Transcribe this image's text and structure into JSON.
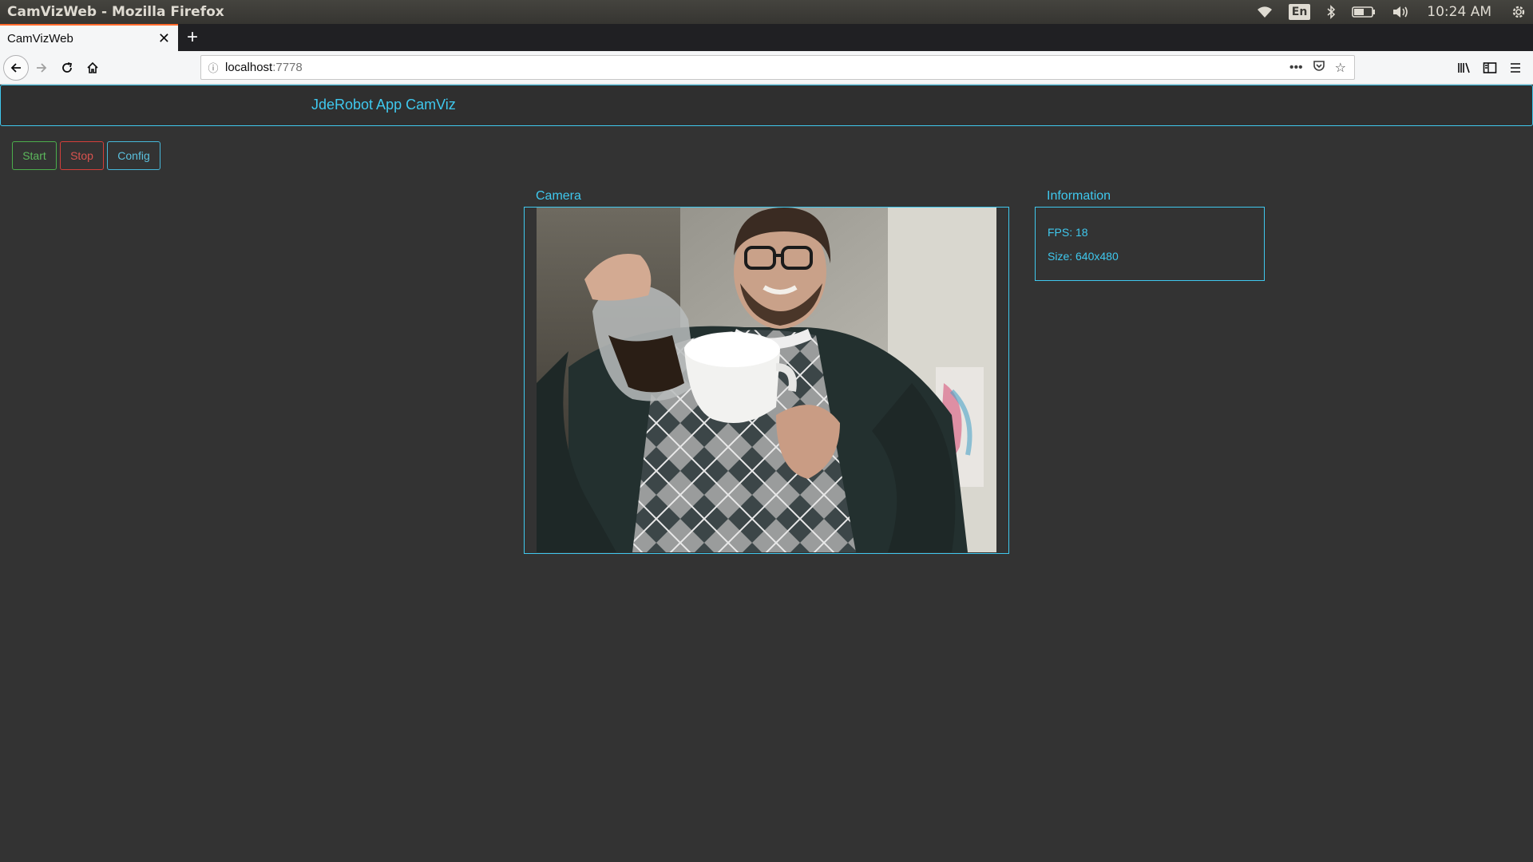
{
  "os": {
    "window_title": "CamVizWeb - Mozilla Firefox",
    "keyboard_layout": "En",
    "clock": "10:24 AM",
    "icons": [
      "wifi-icon",
      "bluetooth-icon",
      "battery-icon",
      "volume-icon",
      "power-gear-icon"
    ]
  },
  "browser": {
    "tab_title": "CamVizWeb",
    "url_host": "localhost",
    "url_port": ":7778",
    "icons": [
      "back-icon",
      "forward-icon",
      "reload-icon",
      "home-icon",
      "info-icon",
      "more-icon",
      "pocket-icon",
      "bookmark-star-icon",
      "library-icon",
      "sidebar-icon",
      "menu-icon"
    ]
  },
  "app": {
    "title": "JdeRobot App CamViz",
    "buttons": {
      "start": "Start",
      "stop": "Stop",
      "config": "Config"
    },
    "camera_label": "Camera",
    "info_label": "Information",
    "fps": "FPS: 18",
    "size": "Size: 640x480"
  },
  "colors": {
    "accent": "#3fc8ee",
    "start": "#5cb85c",
    "stop": "#d9534f",
    "config": "#5bc0de",
    "background": "#333333"
  }
}
